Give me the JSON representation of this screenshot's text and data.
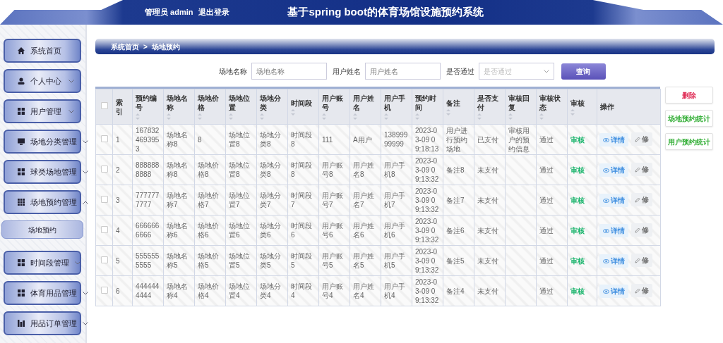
{
  "header": {
    "user_label": "管理员 admin",
    "logout": "退出登录",
    "title": "基于spring boot的体育场馆设施预约系统"
  },
  "sidebar": {
    "items": [
      {
        "label": "系统首页",
        "expanded": false,
        "has_caret": false
      },
      {
        "label": "个人中心",
        "expanded": false,
        "has_caret": true
      },
      {
        "label": "用户管理",
        "expanded": false,
        "has_caret": true
      },
      {
        "label": "场地分类管理",
        "expanded": false,
        "has_caret": true
      },
      {
        "label": "球类场地管理",
        "expanded": false,
        "has_caret": true
      },
      {
        "label": "场地预约管理",
        "expanded": true,
        "has_caret": true,
        "children": [
          {
            "label": "场地预约"
          }
        ]
      },
      {
        "label": "时间段管理",
        "expanded": false,
        "has_caret": true
      },
      {
        "label": "体育用品管理",
        "expanded": false,
        "has_caret": true
      },
      {
        "label": "用品订单管理",
        "expanded": false,
        "has_caret": true
      }
    ]
  },
  "breadcrumb": {
    "items": [
      "系统首页",
      "场地预约"
    ],
    "separator": ">"
  },
  "search": {
    "fields": [
      {
        "kind": "input",
        "label": "场地名称",
        "placeholder": "场地名称"
      },
      {
        "kind": "input",
        "label": "用户姓名",
        "placeholder": "用户姓名"
      },
      {
        "kind": "select",
        "label": "是否通过",
        "placeholder": "是否通过"
      }
    ],
    "button": "查询"
  },
  "table": {
    "header_checkbox": {
      "checked": false
    },
    "columns": [
      {
        "label": "索引",
        "sortable": false
      },
      {
        "label": "预约编号",
        "sortable": true
      },
      {
        "label": "场地名称",
        "sortable": true
      },
      {
        "label": "场地价格",
        "sortable": true
      },
      {
        "label": "场地位置",
        "sortable": true
      },
      {
        "label": "场地分类",
        "sortable": true
      },
      {
        "label": "时间段",
        "sortable": true
      },
      {
        "label": "用户账号",
        "sortable": true
      },
      {
        "label": "用户姓名",
        "sortable": true
      },
      {
        "label": "用户手机",
        "sortable": true
      },
      {
        "label": "预约时间",
        "sortable": true
      },
      {
        "label": "备注",
        "sortable": true
      },
      {
        "label": "是否支付",
        "sortable": true
      },
      {
        "label": "审核回复",
        "sortable": true
      },
      {
        "label": "审核状态",
        "sortable": true
      },
      {
        "label": "审核",
        "sortable": true
      },
      {
        "label": "操作",
        "sortable": false
      }
    ],
    "rows": [
      {
        "checked": false,
        "cells": [
          "1",
          "1678324693953",
          "场地名称8",
          "8",
          "场地位置8",
          "场地分类8",
          "时间段8",
          "111",
          "A用户",
          "13899999999",
          "2023-03-09 09:18:13",
          "用户进行预约场地",
          "已支付",
          "审核用户的预约信息",
          "通过"
        ],
        "audit": "审核",
        "actions": [
          "详情",
          "修"
        ]
      },
      {
        "checked": false,
        "cells": [
          "2",
          "8888888888",
          "场地名称8",
          "场地价格8",
          "场地位置8",
          "场地分类8",
          "时间段8",
          "用户账号8",
          "用户姓名8",
          "用户手机8",
          "2023-03-09 09:13:32",
          "备注8",
          "未支付",
          "",
          "通过"
        ],
        "audit": "审核",
        "actions": [
          "详情",
          "修"
        ]
      },
      {
        "checked": false,
        "cells": [
          "3",
          "7777777777",
          "场地名称7",
          "场地价格7",
          "场地位置7",
          "场地分类7",
          "时间段7",
          "用户账号7",
          "用户姓名7",
          "用户手机7",
          "2023-03-09 09:13:32",
          "备注7",
          "未支付",
          "",
          "通过"
        ],
        "audit": "审核",
        "actions": [
          "详情",
          "修"
        ]
      },
      {
        "checked": false,
        "cells": [
          "4",
          "6666666666",
          "场地名称6",
          "场地价格6",
          "场地位置6",
          "场地分类6",
          "时间段6",
          "用户账号6",
          "用户姓名6",
          "用户手机6",
          "2023-03-09 09:13:32",
          "备注6",
          "未支付",
          "",
          "通过"
        ],
        "audit": "审核",
        "actions": [
          "详情",
          "修"
        ]
      },
      {
        "checked": false,
        "cells": [
          "5",
          "5555555555",
          "场地名称5",
          "场地价格5",
          "场地位置5",
          "场地分类5",
          "时间段5",
          "用户账号5",
          "用户姓名5",
          "用户手机5",
          "2023-03-09 09:13:32",
          "备注5",
          "未支付",
          "",
          "通过"
        ],
        "audit": "审核",
        "actions": [
          "详情",
          "修"
        ]
      },
      {
        "checked": false,
        "cells": [
          "6",
          "4444444444",
          "场地名称4",
          "场地价格4",
          "场地位置4",
          "场地分类4",
          "时间段4",
          "用户账号4",
          "用户姓名4",
          "用户手机4",
          "2023-03-09 09:13:32",
          "备注4",
          "未支付",
          "",
          "通过"
        ],
        "audit": "审核",
        "actions": [
          "详情",
          "修"
        ]
      }
    ]
  },
  "side_buttons": [
    {
      "label": "删除",
      "kind": "danger"
    },
    {
      "label": "场地预约统计",
      "kind": "success"
    },
    {
      "label": "用户预约统计",
      "kind": "success"
    }
  ]
}
